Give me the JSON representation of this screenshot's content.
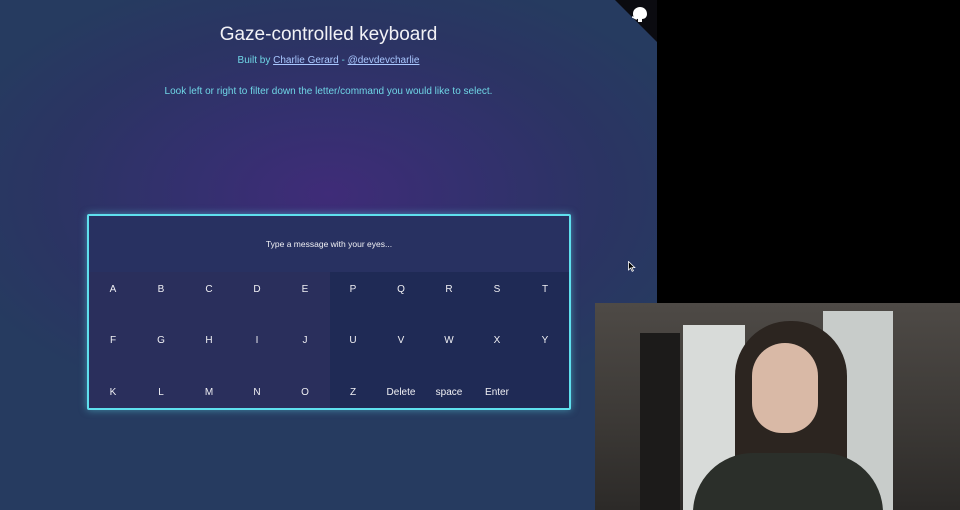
{
  "header": {
    "title": "Gaze-controlled keyboard",
    "byline_prefix": "Built by ",
    "author_link": "Charlie Gerard",
    "byline_separator": " - ",
    "handle_link": "@devdevcharlie",
    "instructions": "Look left or right to filter down the letter/command you would like to select."
  },
  "keyboard": {
    "message_placeholder": "Type a message with your eyes...",
    "left_keys": [
      "A",
      "B",
      "C",
      "D",
      "E",
      "F",
      "G",
      "H",
      "I",
      "J",
      "K",
      "L",
      "M",
      "N",
      "O"
    ],
    "right_keys": [
      "P",
      "Q",
      "R",
      "S",
      "T",
      "U",
      "V",
      "W",
      "X",
      "Y",
      "Z",
      "Delete",
      "space",
      "Enter",
      ""
    ]
  },
  "colors": {
    "accent": "#5fe0ee",
    "link": "#a9c8ff",
    "subtitle": "#6fd6e6",
    "background": "#34306f"
  },
  "icons": {
    "corner": "github-octocat-icon",
    "cursor": "mouse-pointer-icon"
  }
}
